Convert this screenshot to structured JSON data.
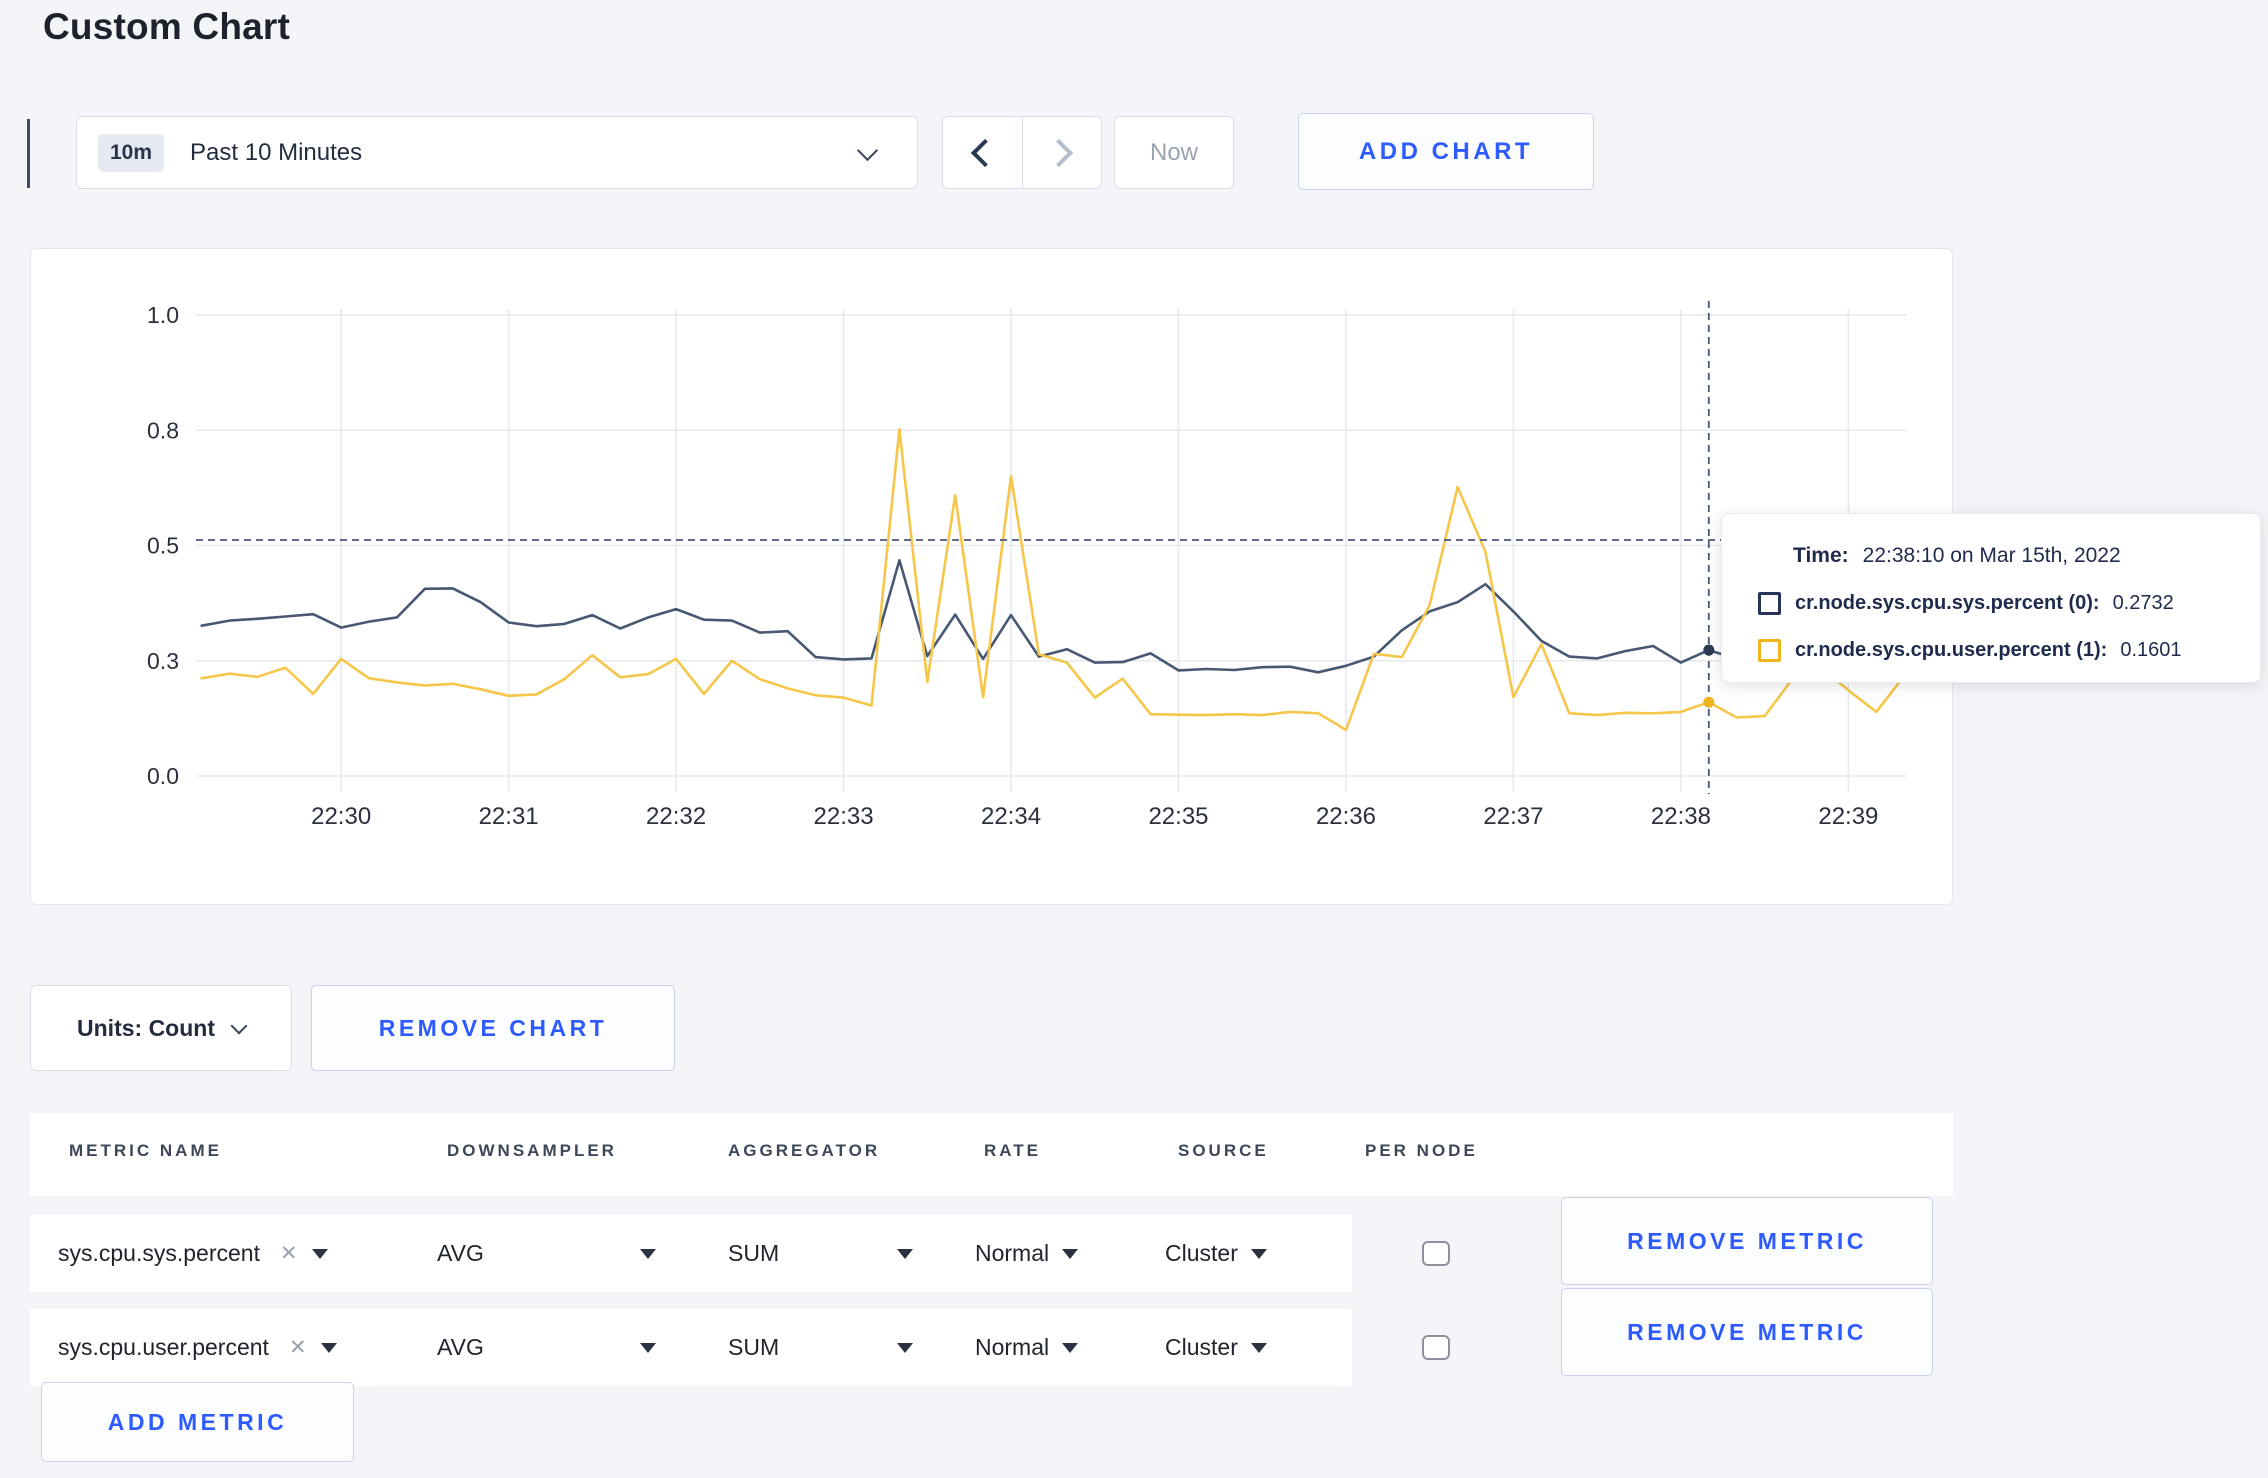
{
  "page": {
    "title": "Custom Chart"
  },
  "toolbar": {
    "range_badge": "10m",
    "range_label": "Past 10 Minutes",
    "now_label": "Now",
    "add_chart_label": "ADD CHART"
  },
  "tooltip": {
    "time_label": "Time:",
    "time_value": "22:38:10 on Mar 15th, 2022",
    "rows": [
      {
        "label": "cr.node.sys.cpu.sys.percent (0):",
        "value": "0.2732",
        "color": "#253557"
      },
      {
        "label": "cr.node.sys.cpu.user.percent (1):",
        "value": "0.1601",
        "color": "#f0b41e"
      }
    ]
  },
  "chart_controls": {
    "units_label": "Units: Count",
    "remove_chart_label": "REMOVE CHART"
  },
  "metrics_table": {
    "headers": {
      "metric": "METRIC NAME",
      "downsampler": "DOWNSAMPLER",
      "aggregator": "AGGREGATOR",
      "rate": "RATE",
      "source": "SOURCE",
      "per_node": "PER NODE"
    },
    "rows": [
      {
        "metric": "sys.cpu.sys.percent",
        "remove_icon": "✕",
        "downsampler": "AVG",
        "aggregator": "SUM",
        "rate": "Normal",
        "source": "Cluster",
        "per_node_checked": false,
        "action": "REMOVE METRIC"
      },
      {
        "metric": "sys.cpu.user.percent",
        "remove_icon": "✕",
        "downsampler": "AVG",
        "aggregator": "SUM",
        "rate": "Normal",
        "source": "Cluster",
        "per_node_checked": false,
        "action": "REMOVE METRIC"
      }
    ],
    "add_metric_label": "ADD METRIC"
  },
  "chart_data": {
    "type": "line",
    "title": "",
    "xlabel": "",
    "ylabel": "",
    "grid": true,
    "grid_color": "#e7e9ee",
    "axis_label_color": "#2a303c",
    "x_domain": [
      -52,
      561
    ],
    "y_domain": [
      0,
      1
    ],
    "x_ticks": [
      {
        "t": 0,
        "label": "22:30"
      },
      {
        "t": 60,
        "label": "22:31"
      },
      {
        "t": 120,
        "label": "22:32"
      },
      {
        "t": 180,
        "label": "22:33"
      },
      {
        "t": 240,
        "label": "22:34"
      },
      {
        "t": 300,
        "label": "22:35"
      },
      {
        "t": 360,
        "label": "22:36"
      },
      {
        "t": 420,
        "label": "22:37"
      },
      {
        "t": 480,
        "label": "22:38"
      },
      {
        "t": 540,
        "label": "22:39"
      }
    ],
    "y_ticks": [
      {
        "v": 0.0,
        "label": "0.0"
      },
      {
        "v": 0.25,
        "label": "0.3"
      },
      {
        "v": 0.5,
        "label": "0.5"
      },
      {
        "v": 0.75,
        "label": "0.8"
      },
      {
        "v": 1.0,
        "label": "1.0"
      }
    ],
    "series": [
      {
        "name": "cr.node.sys.cpu.sys.percent",
        "color": "#475872",
        "points": [
          [
            -50,
            0.326
          ],
          [
            -40,
            0.337
          ],
          [
            -30,
            0.341
          ],
          [
            -20,
            0.346
          ],
          [
            -10,
            0.351
          ],
          [
            0,
            0.322
          ],
          [
            10,
            0.335
          ],
          [
            20,
            0.344
          ],
          [
            30,
            0.406
          ],
          [
            40,
            0.407
          ],
          [
            50,
            0.377
          ],
          [
            60,
            0.333
          ],
          [
            70,
            0.325
          ],
          [
            80,
            0.33
          ],
          [
            90,
            0.349
          ],
          [
            100,
            0.32
          ],
          [
            110,
            0.344
          ],
          [
            120,
            0.362
          ],
          [
            130,
            0.339
          ],
          [
            140,
            0.337
          ],
          [
            150,
            0.311
          ],
          [
            160,
            0.314
          ],
          [
            170,
            0.258
          ],
          [
            180,
            0.253
          ],
          [
            190,
            0.255
          ],
          [
            200,
            0.468
          ],
          [
            210,
            0.26
          ],
          [
            220,
            0.35
          ],
          [
            230,
            0.254
          ],
          [
            240,
            0.349
          ],
          [
            250,
            0.259
          ],
          [
            260,
            0.275
          ],
          [
            270,
            0.246
          ],
          [
            280,
            0.247
          ],
          [
            290,
            0.266
          ],
          [
            300,
            0.229
          ],
          [
            310,
            0.232
          ],
          [
            320,
            0.23
          ],
          [
            330,
            0.236
          ],
          [
            340,
            0.237
          ],
          [
            350,
            0.225
          ],
          [
            360,
            0.239
          ],
          [
            370,
            0.259
          ],
          [
            380,
            0.316
          ],
          [
            390,
            0.357
          ],
          [
            400,
            0.377
          ],
          [
            410,
            0.416
          ],
          [
            420,
            0.357
          ],
          [
            430,
            0.293
          ],
          [
            440,
            0.259
          ],
          [
            450,
            0.255
          ],
          [
            460,
            0.271
          ],
          [
            470,
            0.282
          ],
          [
            480,
            0.246
          ],
          [
            490,
            0.2732
          ],
          [
            500,
            0.254
          ],
          [
            510,
            0.27
          ],
          [
            520,
            0.29
          ],
          [
            530,
            0.3
          ],
          [
            540,
            0.3
          ],
          [
            550,
            0.298
          ],
          [
            561,
            0.3
          ]
        ]
      },
      {
        "name": "cr.node.sys.cpu.user.percent",
        "color": "#f6c64a",
        "points": [
          [
            -50,
            0.212
          ],
          [
            -40,
            0.222
          ],
          [
            -30,
            0.215
          ],
          [
            -20,
            0.235
          ],
          [
            -10,
            0.178
          ],
          [
            0,
            0.254
          ],
          [
            10,
            0.212
          ],
          [
            20,
            0.203
          ],
          [
            30,
            0.196
          ],
          [
            40,
            0.2
          ],
          [
            50,
            0.188
          ],
          [
            60,
            0.174
          ],
          [
            70,
            0.177
          ],
          [
            80,
            0.21
          ],
          [
            90,
            0.262
          ],
          [
            100,
            0.214
          ],
          [
            110,
            0.221
          ],
          [
            120,
            0.254
          ],
          [
            130,
            0.178
          ],
          [
            140,
            0.25
          ],
          [
            150,
            0.21
          ],
          [
            160,
            0.19
          ],
          [
            170,
            0.175
          ],
          [
            180,
            0.17
          ],
          [
            190,
            0.153
          ],
          [
            200,
            0.752
          ],
          [
            210,
            0.204
          ],
          [
            220,
            0.609
          ],
          [
            230,
            0.171
          ],
          [
            240,
            0.65
          ],
          [
            250,
            0.264
          ],
          [
            260,
            0.246
          ],
          [
            270,
            0.17
          ],
          [
            280,
            0.211
          ],
          [
            290,
            0.134
          ],
          [
            300,
            0.133
          ],
          [
            310,
            0.132
          ],
          [
            320,
            0.134
          ],
          [
            330,
            0.132
          ],
          [
            340,
            0.139
          ],
          [
            350,
            0.136
          ],
          [
            360,
            0.1
          ],
          [
            370,
            0.265
          ],
          [
            380,
            0.258
          ],
          [
            390,
            0.371
          ],
          [
            400,
            0.627
          ],
          [
            410,
            0.486
          ],
          [
            420,
            0.171
          ],
          [
            430,
            0.286
          ],
          [
            440,
            0.136
          ],
          [
            450,
            0.132
          ],
          [
            460,
            0.137
          ],
          [
            470,
            0.136
          ],
          [
            480,
            0.139
          ],
          [
            490,
            0.1601
          ],
          [
            500,
            0.127
          ],
          [
            510,
            0.13
          ],
          [
            520,
            0.211
          ],
          [
            530,
            0.236
          ],
          [
            540,
            0.186
          ],
          [
            550,
            0.139
          ],
          [
            561,
            0.225
          ]
        ]
      }
    ],
    "crosshair": {
      "t": 490,
      "v": 0.512,
      "color": "#4a5878"
    },
    "hover_dots": [
      {
        "t": 490,
        "v": 0.2732,
        "color": "#2e3a54"
      },
      {
        "t": 490,
        "v": 0.1601,
        "color": "#efb421"
      }
    ],
    "legend_position": "tooltip"
  }
}
